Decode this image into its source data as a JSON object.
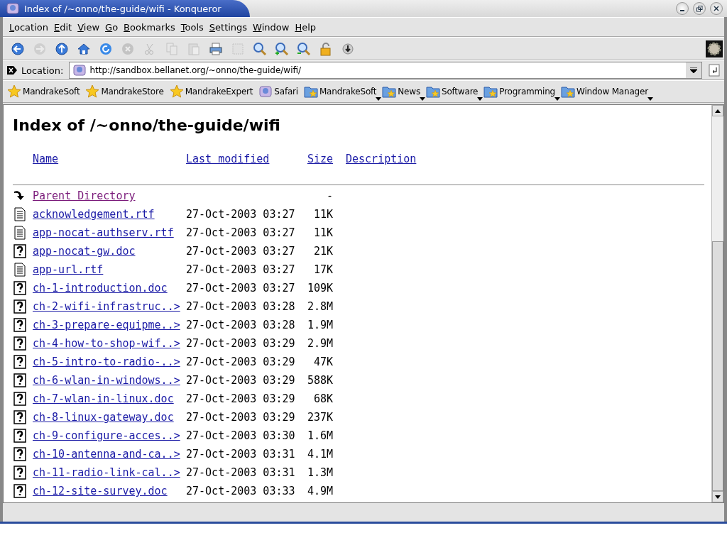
{
  "window": {
    "title": "Index of /~onno/the-guide/wifi - Konqueror"
  },
  "menu": [
    "Location",
    "Edit",
    "View",
    "Go",
    "Bookmarks",
    "Tools",
    "Settings",
    "Window",
    "Help"
  ],
  "toolbar": [
    {
      "kind": "back",
      "disabled": false
    },
    {
      "kind": "forward",
      "disabled": true
    },
    {
      "kind": "up",
      "disabled": false
    },
    {
      "kind": "home",
      "disabled": false
    },
    {
      "kind": "reload",
      "disabled": false
    },
    {
      "kind": "stop",
      "disabled": true
    },
    {
      "kind": "cut",
      "disabled": true
    },
    {
      "kind": "copy",
      "disabled": true
    },
    {
      "kind": "paste",
      "disabled": true
    },
    {
      "kind": "print",
      "disabled": false
    },
    {
      "kind": "printframe",
      "disabled": true
    },
    {
      "kind": "find",
      "disabled": false
    },
    {
      "kind": "zoomin",
      "disabled": false
    },
    {
      "kind": "zoomout",
      "disabled": false
    },
    {
      "kind": "lock",
      "disabled": false
    },
    {
      "kind": "security",
      "disabled": false
    }
  ],
  "location": {
    "label": "Location:",
    "value": "http://sandbox.bellanet.org/~onno/the-guide/wifi/"
  },
  "bookmarks": [
    {
      "kind": "star",
      "label": "MandrakeSoft"
    },
    {
      "kind": "star",
      "label": "MandrakeStore"
    },
    {
      "kind": "star",
      "label": "MandrakeExpert"
    },
    {
      "kind": "site",
      "label": "Safari"
    },
    {
      "kind": "folder",
      "label": "MandrakeSoft"
    },
    {
      "kind": "folder",
      "label": "News"
    },
    {
      "kind": "folder",
      "label": "Software"
    },
    {
      "kind": "folder",
      "label": "Programming"
    },
    {
      "kind": "folder",
      "label": "Window Manager"
    }
  ],
  "page": {
    "heading": "Index of /~onno/the-guide/wifi",
    "columns": [
      "Name",
      "Last modified",
      "Size",
      "Description"
    ],
    "rows": [
      {
        "kind": "back",
        "name": "Parent Directory",
        "modified": "",
        "size": "-",
        "visited": true
      },
      {
        "kind": "text",
        "name": "acknowledgement.rtf",
        "modified": "27-Oct-2003 03:27",
        "size": "11K",
        "visited": false
      },
      {
        "kind": "text",
        "name": "app-nocat-authserv.rtf",
        "modified": "27-Oct-2003 03:27",
        "size": "11K",
        "visited": false
      },
      {
        "kind": "unknown",
        "name": "app-nocat-gw.doc",
        "modified": "27-Oct-2003 03:27",
        "size": "21K",
        "visited": false
      },
      {
        "kind": "text",
        "name": "app-url.rtf",
        "modified": "27-Oct-2003 03:27",
        "size": "17K",
        "visited": false
      },
      {
        "kind": "unknown",
        "name": "ch-1-introduction.doc",
        "modified": "27-Oct-2003 03:27",
        "size": "109K",
        "visited": false
      },
      {
        "kind": "unknown",
        "name": "ch-2-wifi-infrastruc..>",
        "modified": "27-Oct-2003 03:28",
        "size": "2.8M",
        "visited": false
      },
      {
        "kind": "unknown",
        "name": "ch-3-prepare-equipme..>",
        "modified": "27-Oct-2003 03:28",
        "size": "1.9M",
        "visited": false
      },
      {
        "kind": "unknown",
        "name": "ch-4-how-to-shop-wif..>",
        "modified": "27-Oct-2003 03:29",
        "size": "2.9M",
        "visited": false
      },
      {
        "kind": "unknown",
        "name": "ch-5-intro-to-radio-..>",
        "modified": "27-Oct-2003 03:29",
        "size": "47K",
        "visited": false
      },
      {
        "kind": "unknown",
        "name": "ch-6-wlan-in-windows..>",
        "modified": "27-Oct-2003 03:29",
        "size": "588K",
        "visited": false
      },
      {
        "kind": "unknown",
        "name": "ch-7-wlan-in-linux.doc",
        "modified": "27-Oct-2003 03:29",
        "size": "68K",
        "visited": false
      },
      {
        "kind": "unknown",
        "name": "ch-8-linux-gateway.doc",
        "modified": "27-Oct-2003 03:29",
        "size": "237K",
        "visited": false
      },
      {
        "kind": "unknown",
        "name": "ch-9-configure-acces..>",
        "modified": "27-Oct-2003 03:30",
        "size": "1.6M",
        "visited": false
      },
      {
        "kind": "unknown",
        "name": "ch-10-antenna-and-ca..>",
        "modified": "27-Oct-2003 03:31",
        "size": "4.1M",
        "visited": false
      },
      {
        "kind": "unknown",
        "name": "ch-11-radio-link-cal..>",
        "modified": "27-Oct-2003 03:31",
        "size": "1.3M",
        "visited": false
      },
      {
        "kind": "unknown",
        "name": "ch-12-site-survey.doc",
        "modified": "27-Oct-2003 03:33",
        "size": "4.9M",
        "visited": false
      }
    ]
  }
}
